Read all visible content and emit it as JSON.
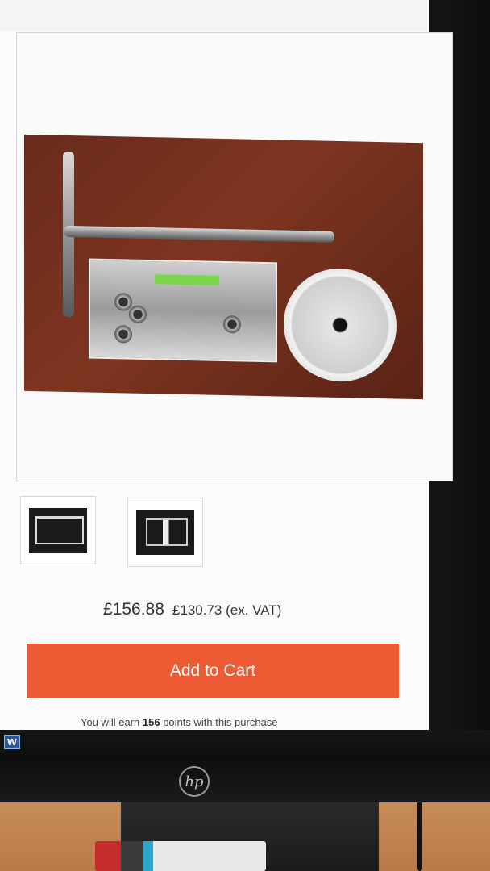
{
  "product": {
    "price": "£156.88",
    "price_ex_vat": "£130.73 (ex. VAT)",
    "cart_button_label": "Add to Cart",
    "points_prefix": "You will earn",
    "points_value": "156",
    "points_suffix": "points with this purchase"
  },
  "gallery": {
    "thumbnail_count": 2
  },
  "monitor": {
    "brand_logo": "hp",
    "taskbar_icon": "W"
  },
  "colors": {
    "cart_button": "#ec5b34",
    "page_background": "#fbfbfb"
  },
  "icons": [
    "word-app-icon",
    "hp-logo-icon"
  ]
}
